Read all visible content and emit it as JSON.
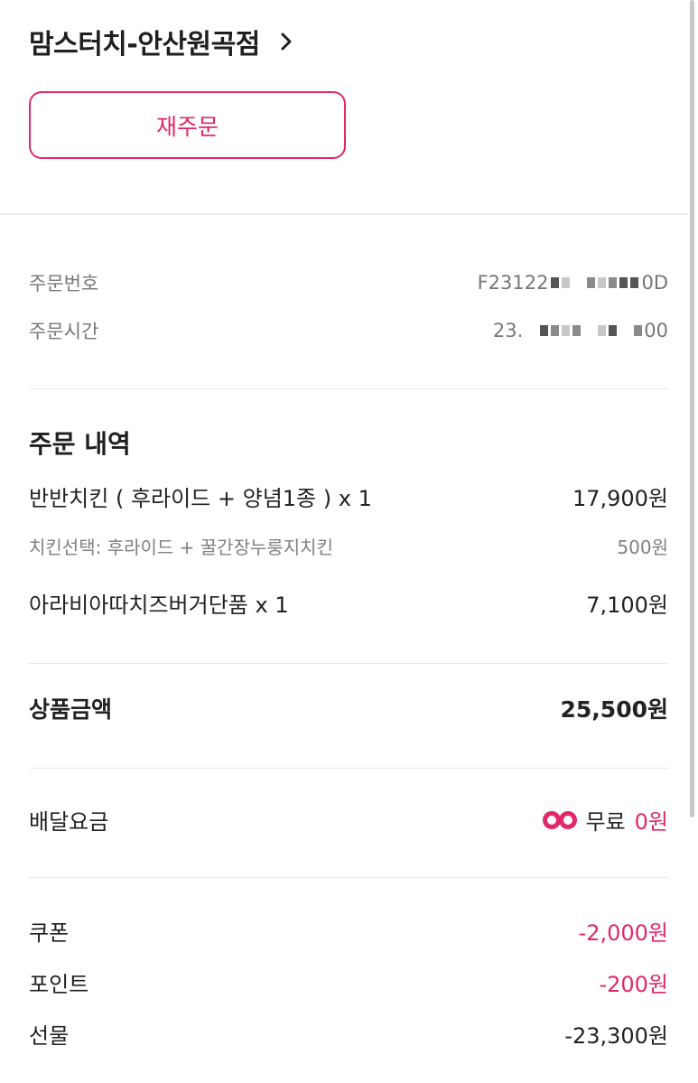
{
  "store": {
    "name": "맘스터치-안산원곡점"
  },
  "reorder": {
    "label": "재주문"
  },
  "order_info": {
    "number_label": "주문번호",
    "number_prefix": "F23122",
    "number_suffix": "0D",
    "time_label": "주문시간",
    "time_prefix": "23.",
    "time_suffix": "00"
  },
  "order_details": {
    "title": "주문 내역",
    "items": [
      {
        "name": "반반치킨 ( 후라이드 + 양념1종 ) x 1",
        "price": "17,900원",
        "type": "main"
      },
      {
        "name": "치킨선택: 후라이드 + 꿀간장누룽지치킨",
        "price": "500원",
        "type": "sub"
      },
      {
        "name": "아라비아따치즈버거단품 x 1",
        "price": "7,100원",
        "type": "main"
      }
    ]
  },
  "subtotal": {
    "label": "상품금액",
    "value": "25,500원"
  },
  "delivery": {
    "label": "배달요금",
    "free_label": "무료",
    "value": "0원"
  },
  "discounts": {
    "coupon_label": "쿠폰",
    "coupon_value": "-2,000원",
    "point_label": "포인트",
    "point_value": "-200원",
    "gift_label": "선물",
    "gift_value": "-23,300원"
  },
  "colors": {
    "accent": "#e0286b",
    "text": "#222222",
    "muted": "#777777",
    "divider": "#eeeeee"
  },
  "icons": {
    "store_chevron": "chevron-right-icon",
    "delivery_logo": "baemin-club-logo-icon"
  }
}
